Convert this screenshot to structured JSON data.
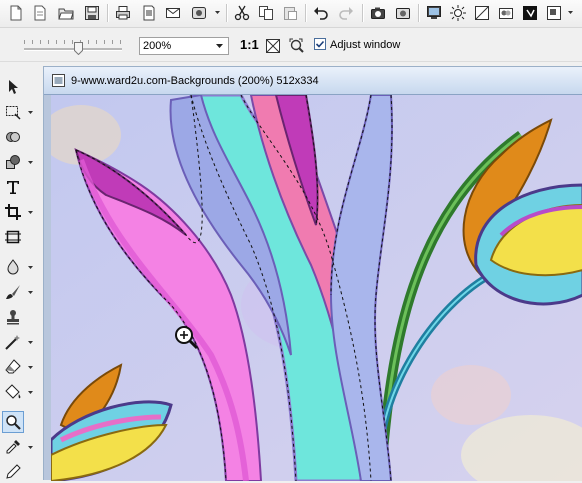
{
  "toolbar": {
    "buttons": [
      "new-file-icon",
      "page-icon",
      "open-folder-icon",
      "save-icon",
      "print-icon",
      "print-preview-icon",
      "email-icon",
      "capture-icon",
      "cut-icon",
      "copy-icon",
      "paste-icon",
      "undo-icon",
      "redo-icon",
      "camera-icon",
      "scanner-icon",
      "monitor-icon",
      "brightness-icon",
      "levels-icon",
      "color-adjust-icon",
      "flag-icon",
      "resize-icon"
    ]
  },
  "options_bar": {
    "zoom_value": "200%",
    "actual_size_label": "1:1",
    "adjust_window_checked": true,
    "adjust_window_label": "Adjust window"
  },
  "tools": [
    "arrow-tool-icon",
    "lasso-select-icon",
    "ellipse-select-icon",
    "shapes-icon",
    "text-tool-icon",
    "crop-tool-icon",
    "transform-icon",
    "dropper-icon",
    "brush-icon",
    "stamp-icon",
    "magic-wand-icon",
    "eraser-icon",
    "fill-icon",
    "zoom-tool-icon",
    "color-picker-icon",
    "pencil-icon"
  ],
  "document": {
    "title": "9-www.ward2u.com-Backgrounds (200%) 512x334"
  },
  "colors": {
    "selection_bg": "#cfe3f7",
    "canvas_bg": "#c8cbf2",
    "title_gradient_top": "#eaf1fb",
    "title_gradient_bottom": "#c7d8ee"
  }
}
